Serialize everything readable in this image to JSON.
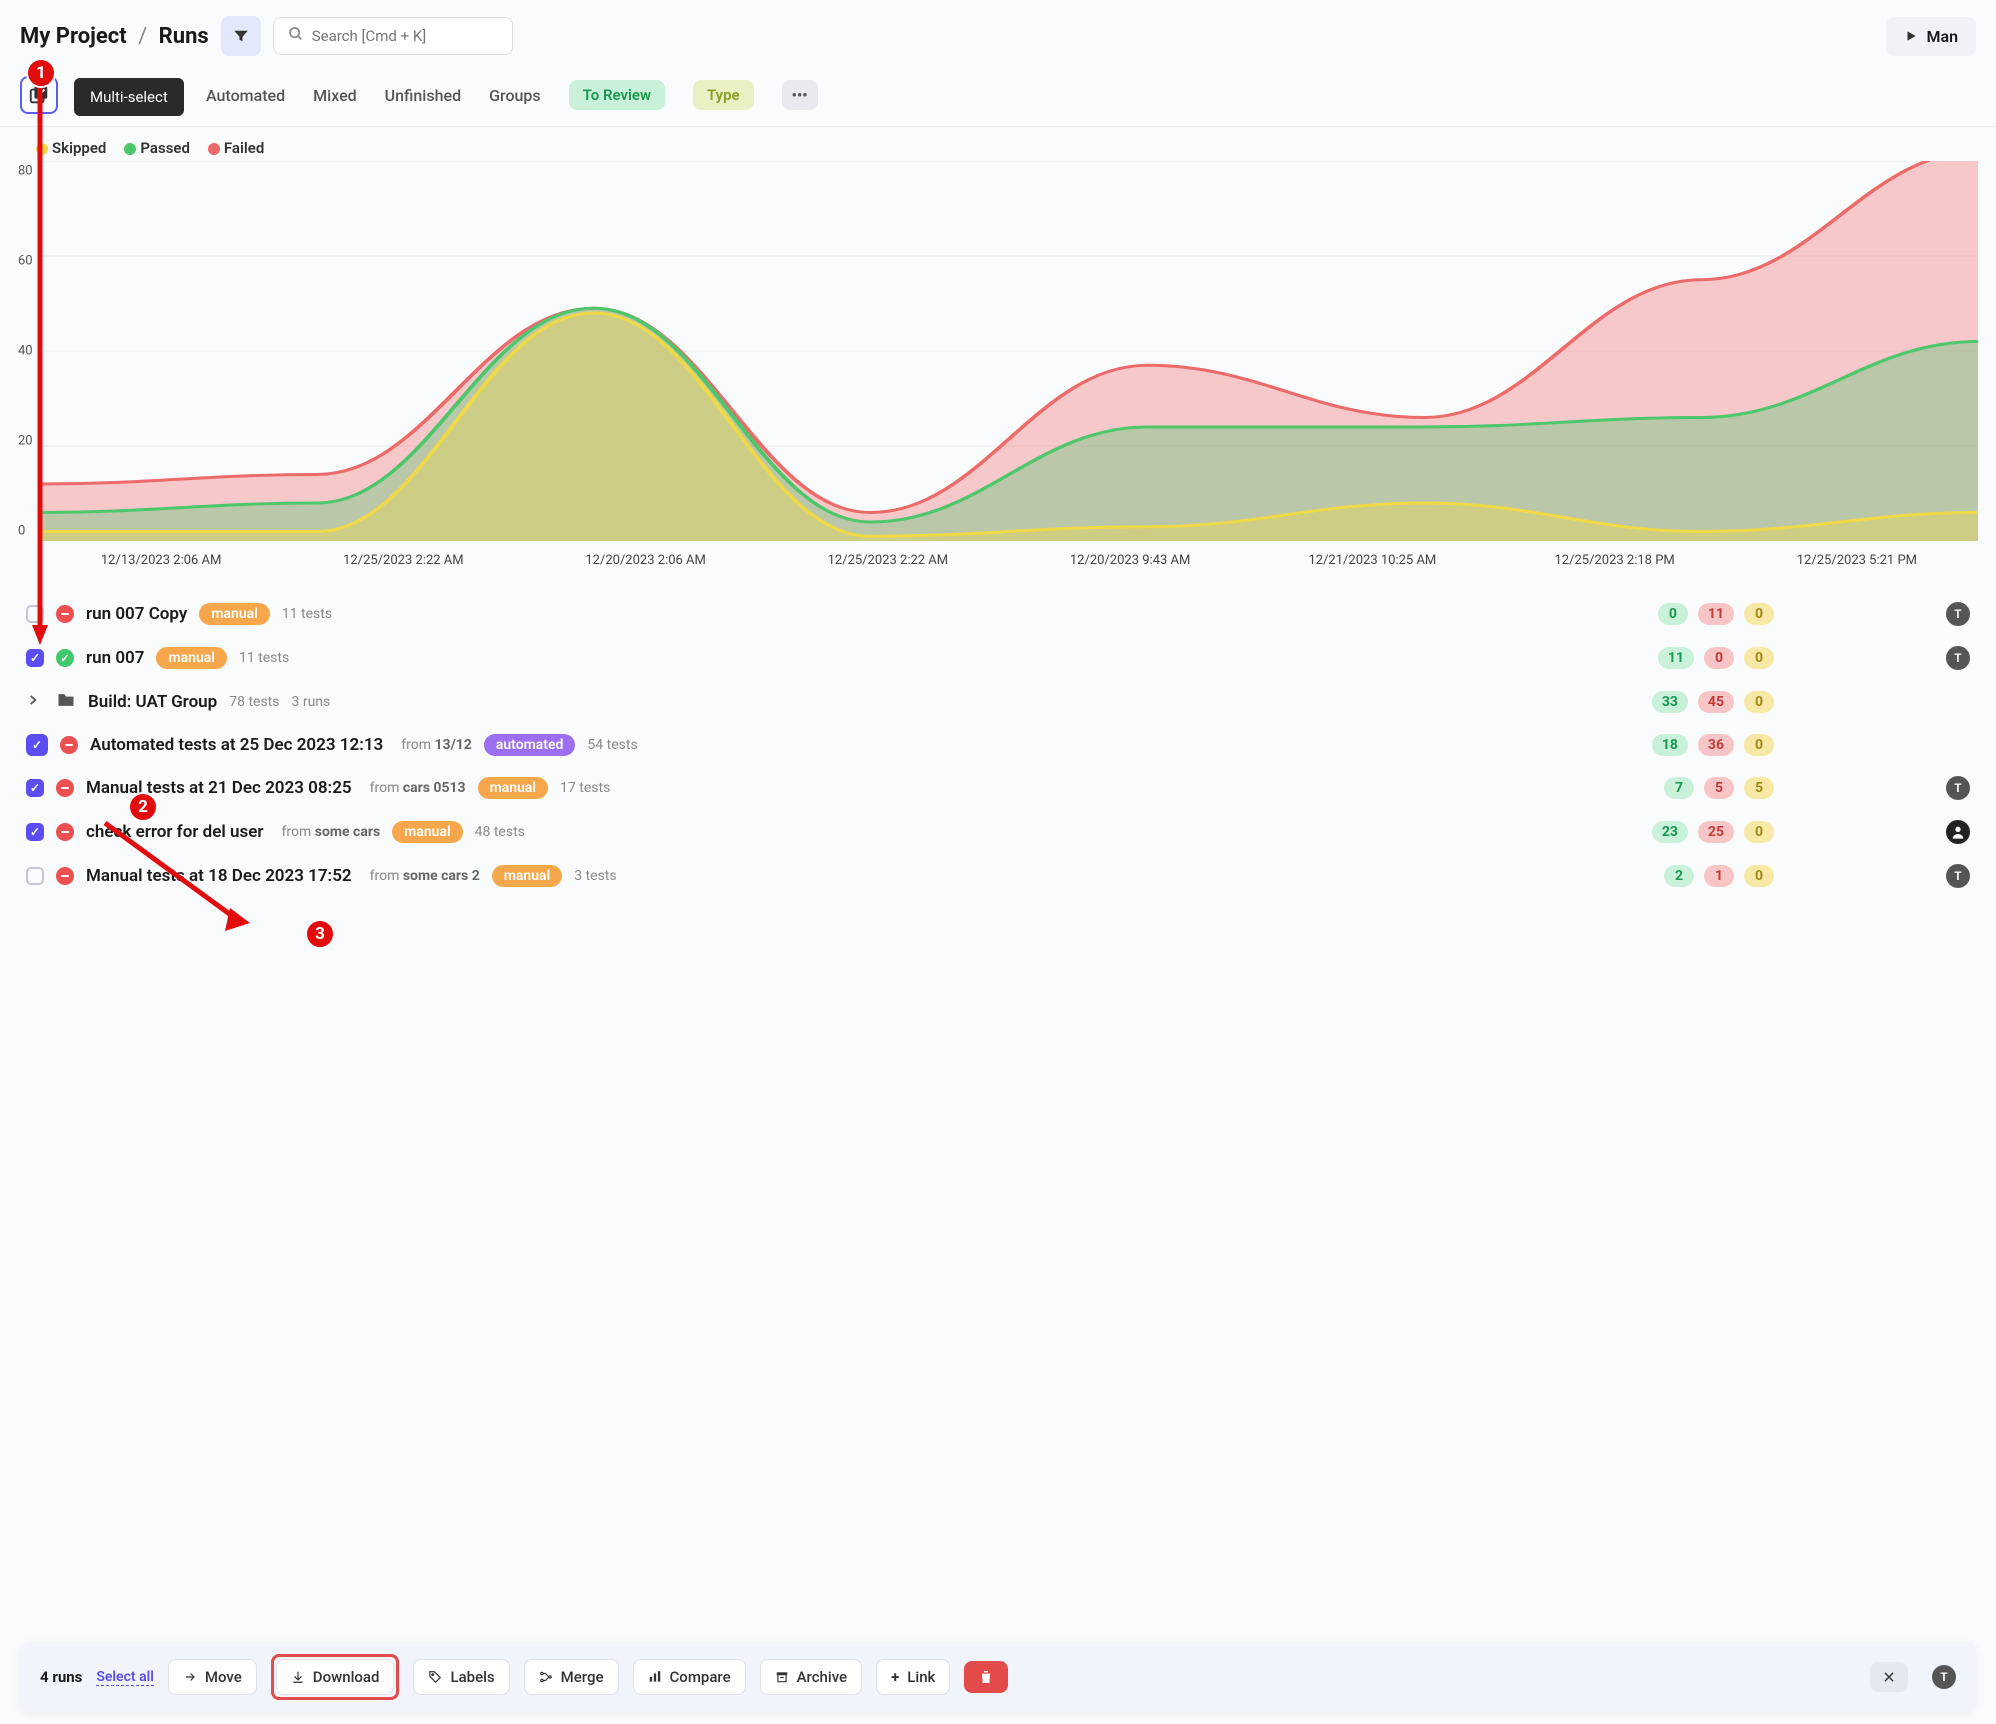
{
  "breadcrumb": {
    "project": "My Project",
    "section": "Runs"
  },
  "search": {
    "placeholder": "Search [Cmd + K]"
  },
  "header_button": "Man",
  "multiselect_tooltip": "Multi-select",
  "tabs": {
    "automated": "Automated",
    "mixed": "Mixed",
    "unfinished": "Unfinished",
    "groups": "Groups",
    "to_review": "To Review",
    "type": "Type"
  },
  "legend": {
    "skipped": "Skipped",
    "passed": "Passed",
    "failed": "Failed"
  },
  "chart_data": {
    "type": "area",
    "ylim": [
      0,
      80
    ],
    "yticks": [
      0,
      20,
      40,
      60,
      80
    ],
    "categories": [
      "12/13/2023 2:06 AM",
      "12/25/2023 2:22 AM",
      "12/20/2023 2:06 AM",
      "12/25/2023 2:22 AM",
      "12/20/2023 9:43 AM",
      "12/21/2023 10:25 AM",
      "12/25/2023 2:18 PM",
      "12/25/2023 5:21 PM"
    ],
    "series": [
      {
        "name": "Skipped",
        "color": "#f0d946",
        "values": [
          2,
          2,
          48,
          1,
          3,
          8,
          2,
          6
        ]
      },
      {
        "name": "Passed",
        "color": "#4cc76c",
        "values": [
          6,
          8,
          49,
          4,
          24,
          24,
          26,
          42
        ]
      },
      {
        "name": "Failed",
        "color": "#ed6a6a",
        "values": [
          12,
          14,
          49,
          6,
          37,
          26,
          55,
          82
        ]
      }
    ]
  },
  "runs": [
    {
      "checked": false,
      "status": "red",
      "title": "run 007 Copy",
      "tag": "manual",
      "meta": "11 tests",
      "counts": [
        "0",
        "11",
        "0"
      ],
      "avatar": "T"
    },
    {
      "checked": true,
      "status": "green",
      "title": "run 007",
      "tag": "manual",
      "meta": "11 tests",
      "counts": [
        "11",
        "0",
        "0"
      ],
      "avatar": "T"
    },
    {
      "folder": true,
      "title": "Build: UAT Group",
      "meta1": "78 tests",
      "meta2": "3 runs",
      "counts": [
        "33",
        "45",
        "0"
      ]
    },
    {
      "checked": true,
      "outline": true,
      "status": "red",
      "title": "Automated tests at 25 Dec 2023 12:13",
      "from": "13/12",
      "tag": "automated",
      "meta": "54 tests",
      "counts": [
        "18",
        "36",
        "0"
      ]
    },
    {
      "checked": true,
      "status": "red",
      "title": "Manual tests at 21 Dec 2023 08:25",
      "from": "cars 0513",
      "tag": "manual",
      "meta": "17 tests",
      "counts": [
        "7",
        "5",
        "5"
      ],
      "avatar": "T"
    },
    {
      "checked": true,
      "status": "red",
      "title": "check error for del user",
      "from": "some cars",
      "tag": "manual",
      "meta": "48 tests",
      "counts": [
        "23",
        "25",
        "0"
      ],
      "avatar": "person"
    },
    {
      "checked": false,
      "status": "red",
      "title": "Manual tests at 18 Dec 2023 17:52",
      "from": "some cars 2",
      "tag": "manual",
      "meta": "3 tests",
      "counts": [
        "2",
        "1",
        "0"
      ],
      "avatar": "T"
    }
  ],
  "from_label": "from",
  "action_bar": {
    "summary": "4 runs",
    "select_all": "Select all",
    "move": "Move",
    "download": "Download",
    "labels": "Labels",
    "merge": "Merge",
    "compare": "Compare",
    "archive": "Archive",
    "link": "Link"
  },
  "steps": {
    "s1": "1",
    "s2": "2",
    "s3": "3"
  }
}
